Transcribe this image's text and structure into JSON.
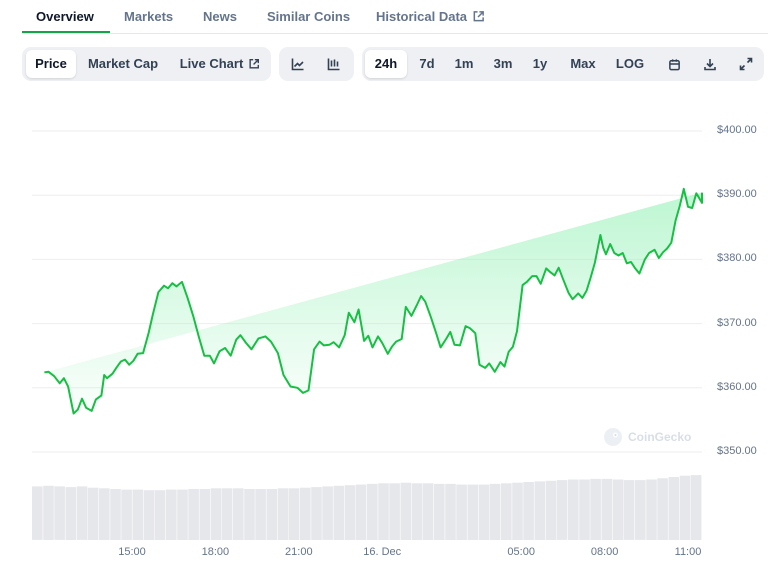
{
  "nav_tabs": [
    {
      "label": "Overview",
      "active": true
    },
    {
      "label": "Markets",
      "active": false
    },
    {
      "label": "News",
      "active": false
    },
    {
      "label": "Similar Coins",
      "active": false
    },
    {
      "label": "Historical Data",
      "active": false,
      "external": true
    }
  ],
  "chart_modes": [
    {
      "label": "Price",
      "active": true
    },
    {
      "label": "Market Cap",
      "active": false
    },
    {
      "label": "Live Chart",
      "active": false,
      "external": true
    }
  ],
  "chart_types": [
    {
      "icon": "line-chart-icon",
      "active": false
    },
    {
      "icon": "candlestick-chart-icon",
      "active": false
    }
  ],
  "ranges": [
    {
      "label": "24h",
      "active": true
    },
    {
      "label": "7d",
      "active": false
    },
    {
      "label": "1m",
      "active": false
    },
    {
      "label": "3m",
      "active": false
    },
    {
      "label": "1y",
      "active": false
    },
    {
      "label": "Max",
      "active": false
    },
    {
      "label": "LOG",
      "active": false
    }
  ],
  "tools": [
    {
      "icon": "calendar-icon"
    },
    {
      "icon": "download-icon"
    },
    {
      "icon": "fullscreen-icon"
    }
  ],
  "watermark": "CoinGecko",
  "colors": {
    "line": "#16c043",
    "fill_top": "#86efac",
    "volume": "#e5e7eb",
    "grid": "#eeeeee",
    "accent": "#16a34a"
  },
  "chart_data": {
    "type": "area",
    "title": "",
    "xlabel": "",
    "ylabel": "",
    "ylim": [
      345,
      405
    ],
    "y_ticks": [
      350,
      360,
      370,
      380,
      390,
      400
    ],
    "y_tick_labels": [
      "$350.00",
      "$360.00",
      "$370.00",
      "$380.00",
      "$390.00",
      "$400.00"
    ],
    "x_ticks": [
      {
        "label": "15:00",
        "t": 3.0
      },
      {
        "label": "18:00",
        "t": 6.0
      },
      {
        "label": "21:00",
        "t": 9.0
      },
      {
        "label": "16. Dec",
        "t": 12.0
      },
      {
        "label": "05:00",
        "t": 17.0
      },
      {
        "label": "08:00",
        "t": 20.0
      },
      {
        "label": "11:00",
        "t": 23.0
      }
    ],
    "x_unit_note": "hours",
    "grid": true,
    "legend": "none",
    "series": [
      {
        "t": [
          -0.15,
          0.0,
          0.2,
          0.4,
          0.55,
          0.7,
          0.9,
          1.05,
          1.2,
          1.35,
          1.55,
          1.7,
          1.9,
          2.0,
          2.1,
          2.3,
          2.45,
          2.6,
          2.75,
          2.9,
          3.05,
          3.2,
          3.4,
          3.6,
          3.75,
          3.95,
          4.15,
          4.3,
          4.45,
          4.6,
          4.8,
          5.0,
          5.2,
          5.4,
          5.6,
          5.8,
          5.95,
          6.15,
          6.35,
          6.55,
          6.75,
          6.9,
          7.1,
          7.3,
          7.55,
          7.8,
          8.0,
          8.25,
          8.45,
          8.7,
          8.95,
          9.15,
          9.35,
          9.55,
          9.75,
          9.9,
          10.1,
          10.25,
          10.45,
          10.65,
          10.8,
          11.0,
          11.15,
          11.35,
          11.5,
          11.65,
          11.85,
          12.0,
          12.2,
          12.35,
          12.5,
          12.7,
          12.85,
          13.05,
          13.25,
          13.4,
          13.55,
          13.75,
          13.95,
          14.1,
          14.3,
          14.45,
          14.6,
          14.8,
          15.0,
          15.15,
          15.35,
          15.5,
          15.7,
          15.85,
          16.05,
          16.25,
          16.4,
          16.55,
          16.7,
          16.85,
          17.05,
          17.2,
          17.4,
          17.55,
          17.7,
          17.9,
          18.05,
          18.2,
          18.35,
          18.5,
          18.7,
          18.85,
          19.05,
          19.2,
          19.35,
          19.5,
          19.65,
          19.85,
          19.95,
          20.05,
          20.2,
          20.35,
          20.5,
          20.65,
          20.8,
          20.95,
          21.1,
          21.25,
          21.45,
          21.6,
          21.8,
          21.95,
          22.1,
          22.25,
          22.4,
          22.55,
          22.7,
          22.85,
          23.0,
          23.15,
          23.3,
          23.45,
          23.6,
          23.75,
          23.85,
          23.95
        ],
        "values": [
          362.4,
          362.5,
          361.8,
          360.7,
          361.5,
          360.2,
          356.0,
          356.6,
          358.3,
          356.9,
          356.4,
          358.2,
          358.8,
          362.0,
          361.5,
          362.2,
          363.2,
          364.1,
          364.4,
          363.6,
          364.2,
          365.3,
          365.4,
          368.6,
          371.4,
          374.9,
          375.9,
          375.5,
          376.3,
          375.8,
          376.5,
          374.0,
          371.2,
          368.0,
          365.0,
          365.0,
          363.8,
          365.7,
          366.2,
          365.0,
          367.5,
          368.2,
          367.0,
          366.0,
          367.7,
          368.0,
          367.2,
          365.4,
          362.0,
          360.2,
          360.0,
          359.2,
          359.6,
          366.0,
          367.2,
          366.6,
          366.7,
          367.1,
          366.3,
          368.2,
          371.7,
          370.2,
          372.2,
          367.3,
          368.1,
          366.3,
          368.0,
          367.0,
          365.3,
          366.4,
          367.2,
          367.6,
          372.6,
          371.2,
          372.9,
          374.3,
          373.4,
          371.0,
          368.4,
          366.3,
          367.6,
          368.7,
          366.7,
          366.6,
          369.6,
          369.3,
          368.5,
          363.6,
          363.1,
          363.8,
          362.5,
          364.0,
          363.3,
          365.6,
          366.4,
          368.8,
          376.0,
          376.5,
          377.4,
          377.4,
          376.2,
          378.6,
          378.0,
          377.5,
          378.7,
          377.0,
          374.8,
          373.8,
          374.7,
          374.0,
          375.1,
          377.2,
          379.5,
          383.8,
          381.8,
          380.8,
          382.4,
          381.0,
          380.6,
          381.0,
          379.4,
          379.6,
          378.6,
          377.8,
          380.0,
          381.0,
          381.5,
          380.2,
          381.1,
          381.7,
          382.6,
          386.0,
          388.3,
          391.0,
          388.2,
          388.0,
          390.3,
          389.2,
          388.8,
          390.4
        ]
      }
    ],
    "volume_relative": [
      0.85,
      0.86,
      0.85,
      0.84,
      0.85,
      0.83,
      0.82,
      0.81,
      0.8,
      0.8,
      0.79,
      0.79,
      0.8,
      0.8,
      0.81,
      0.81,
      0.82,
      0.82,
      0.82,
      0.81,
      0.81,
      0.81,
      0.82,
      0.82,
      0.83,
      0.84,
      0.85,
      0.86,
      0.87,
      0.88,
      0.89,
      0.9,
      0.9,
      0.91,
      0.9,
      0.9,
      0.89,
      0.89,
      0.88,
      0.88,
      0.88,
      0.89,
      0.9,
      0.91,
      0.92,
      0.93,
      0.94,
      0.95,
      0.96,
      0.96,
      0.97,
      0.97,
      0.96,
      0.95,
      0.95,
      0.96,
      0.98,
      1.0,
      1.02,
      1.03
    ]
  }
}
